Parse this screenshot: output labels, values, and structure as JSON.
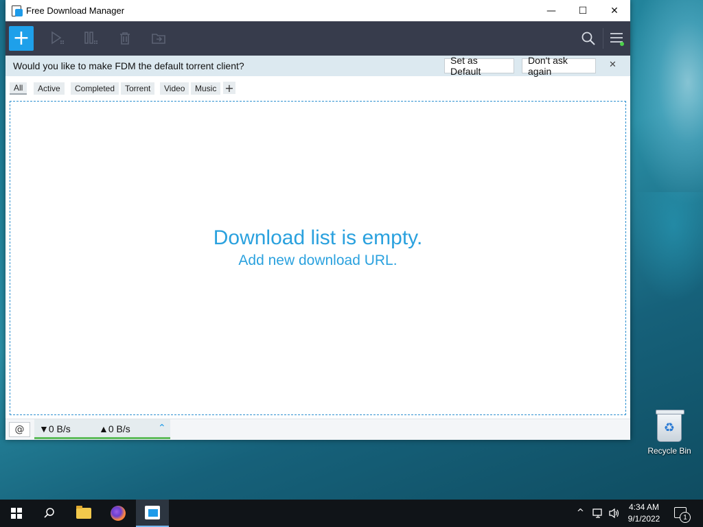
{
  "window": {
    "title": "Free Download Manager",
    "controls": {
      "minimize": "—",
      "maximize": "☐",
      "close": "✕"
    }
  },
  "toolbar": {
    "add_label": "+",
    "icons": [
      "resume-icon",
      "pause-icon",
      "delete-icon",
      "move-to-folder-icon",
      "search-icon",
      "menu-icon"
    ]
  },
  "notice": {
    "message": "Would you like to make FDM the default torrent client?",
    "set_default": "Set as Default",
    "dont_ask": "Don't ask again",
    "close": "✕"
  },
  "filters": {
    "tabs": [
      "All",
      "Active",
      "Completed",
      "Torrent",
      "Video",
      "Music"
    ],
    "active": "All",
    "add": "+"
  },
  "main": {
    "empty_title": "Download list is empty.",
    "empty_sub": "Add new download URL."
  },
  "status": {
    "snail": "@",
    "download_speed": "▼0 B/s",
    "upload_speed": "▲0 B/s",
    "expand": "⌃"
  },
  "desktop": {
    "recycle_bin": "Recycle Bin"
  },
  "taskbar": {
    "time": "4:34 AM",
    "date": "9/1/2022",
    "notification_count": "1"
  },
  "colors": {
    "accent": "#1ea0ea",
    "toolbar_bg": "#373c4c",
    "notice_bg": "#dce9f0",
    "empty_text": "#2aa1de",
    "speed_bar": "#5dbb5a"
  }
}
